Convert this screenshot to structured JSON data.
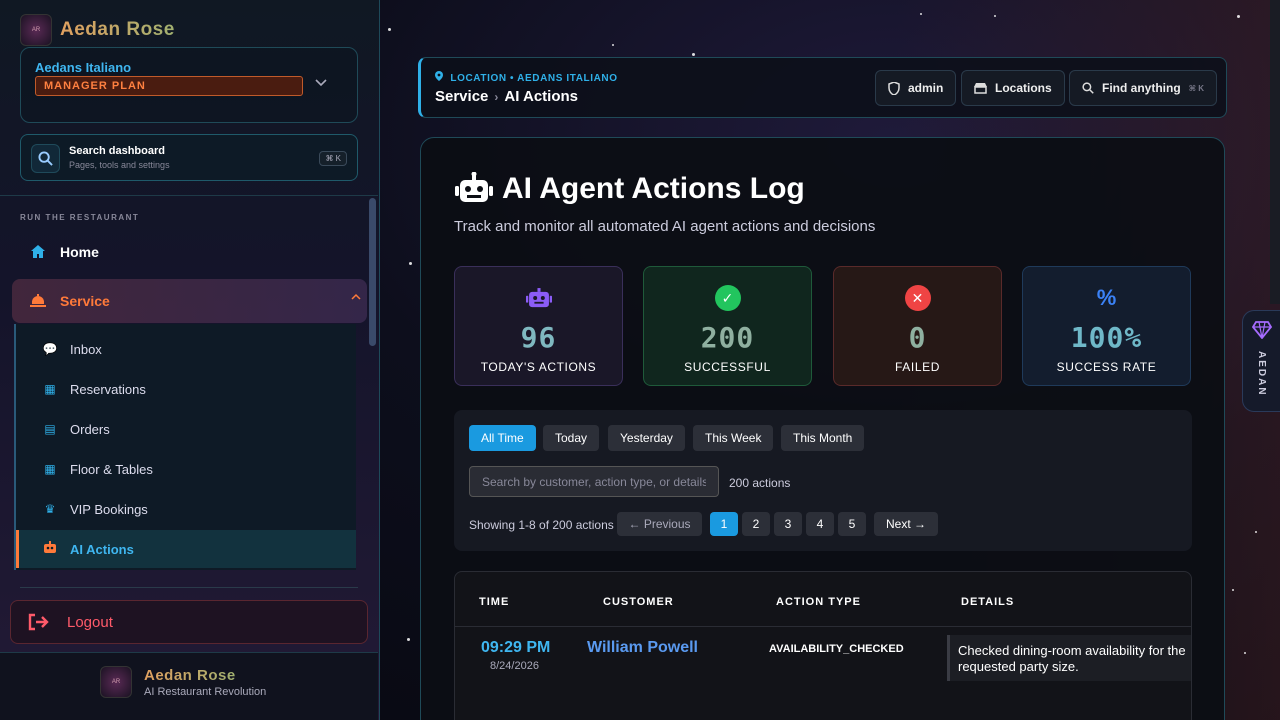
{
  "brand": {
    "name": "Aedan Rose",
    "tagline": "AI Restaurant Revolution"
  },
  "org": {
    "name": "Aedans Italiano",
    "plan": "MANAGER PLAN"
  },
  "search": {
    "title": "Search dashboard",
    "subtitle": "Pages, tools and settings",
    "shortcut": "⌘ K"
  },
  "sidebar": {
    "section_label": "RUN THE RESTAURANT",
    "home": "Home",
    "service": "Service",
    "items": [
      {
        "label": "Inbox",
        "icon": "chat-icon"
      },
      {
        "label": "Reservations",
        "icon": "calendar-icon"
      },
      {
        "label": "Orders",
        "icon": "receipt-icon"
      },
      {
        "label": "Floor & Tables",
        "icon": "grid-icon"
      },
      {
        "label": "VIP Bookings",
        "icon": "crown-icon"
      },
      {
        "label": "AI Actions",
        "icon": "robot-icon"
      }
    ],
    "logout": "Logout"
  },
  "topbar": {
    "location": "LOCATION • AEDANS ITALIANO",
    "crumb_parent": "Service",
    "crumb_current": "AI Actions",
    "admin": "admin",
    "locations": "Locations",
    "find": "Find anything",
    "find_shortcut": "⌘ K"
  },
  "page": {
    "title": "AI Agent Actions Log",
    "subtitle": "Track and monitor all automated AI agent actions and decisions"
  },
  "stats": [
    {
      "value": "96",
      "label": "TODAY'S ACTIONS",
      "color": "#8b5cf6"
    },
    {
      "value": "200",
      "label": "SUCCESSFUL",
      "color": "#22c55e"
    },
    {
      "value": "0",
      "label": "FAILED",
      "color": "#ef4444"
    },
    {
      "value": "100%",
      "label": "SUCCESS RATE",
      "color": "#3b82f6"
    }
  ],
  "filters": {
    "ranges": [
      "All Time",
      "Today",
      "Yesterday",
      "This Week",
      "This Month"
    ],
    "active_range": "All Time",
    "search_placeholder": "Search by customer, action type, or details",
    "count": "200 actions",
    "showing": "Showing 1-8 of 200 actions",
    "prev": "← Previous",
    "next": "Next →",
    "pages": [
      "1",
      "2",
      "3",
      "4",
      "5"
    ],
    "current_page": "1"
  },
  "table": {
    "headers": [
      "TIME",
      "CUSTOMER",
      "ACTION TYPE",
      "DETAILS"
    ],
    "rows": [
      {
        "time": "09:29 PM",
        "date": "8/24/2026",
        "customer": "William Powell",
        "action_type": "AVAILABILITY_CHECKED",
        "details": "Checked dining-room availability for the requested party size."
      }
    ]
  },
  "right_tab": {
    "label": "AEDAN"
  }
}
